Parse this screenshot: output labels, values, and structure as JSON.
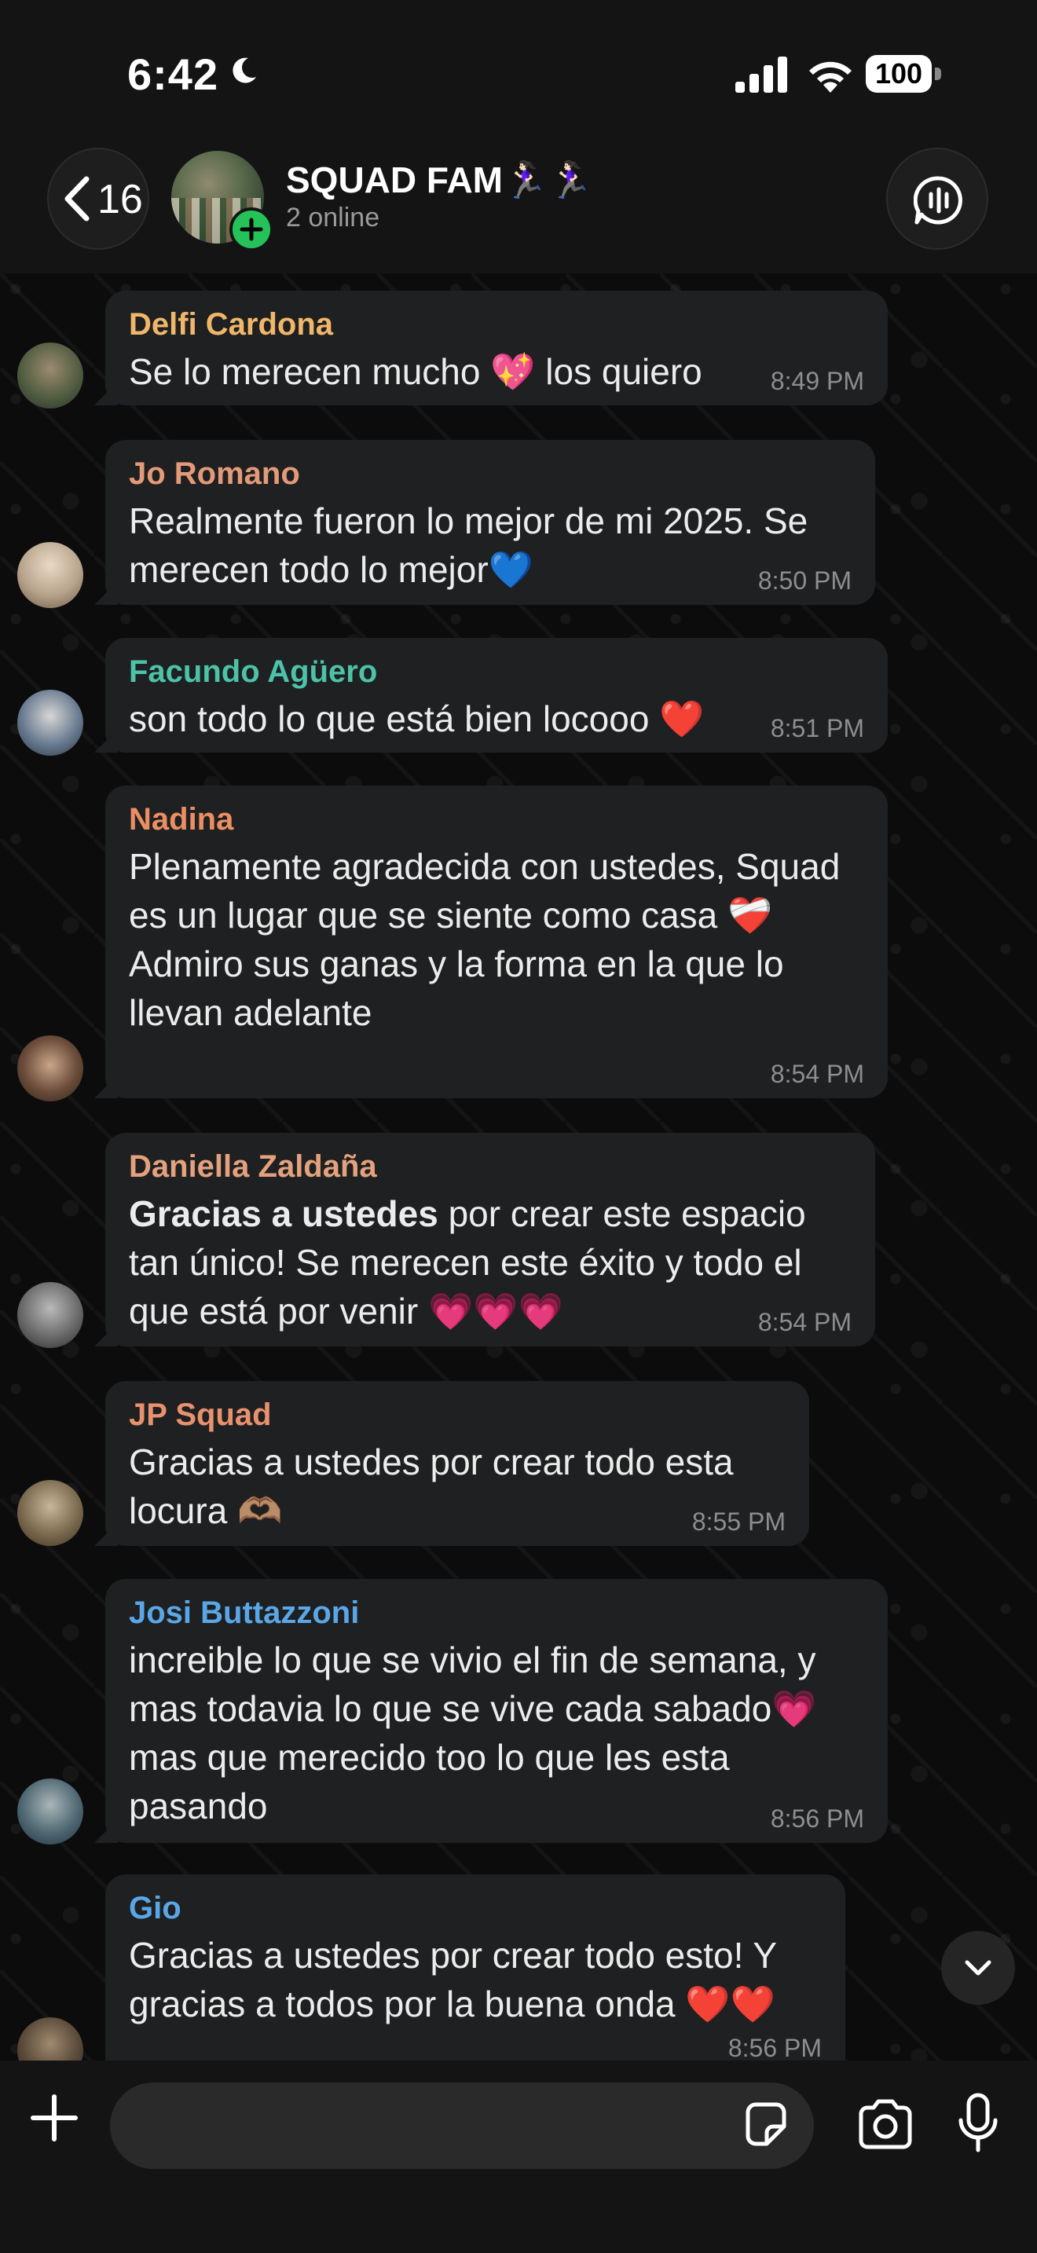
{
  "status_bar": {
    "time": "6:42",
    "battery": "100"
  },
  "header": {
    "back_count": "16",
    "group_name": "SQUAD FAM🏃🏻‍♀️🏃🏻‍♀️",
    "group_status": "2 online"
  },
  "colors": {
    "bubble": "#1f2021",
    "delfi": "#f0b76a",
    "jo": "#e39a78",
    "facundo": "#4cc2a9",
    "nadina": "#eb8f63",
    "daniella": "#e4a17e",
    "jp": "#e8916e",
    "josi": "#5aa7e8",
    "gio": "#5aa7e8"
  },
  "messages": [
    {
      "sender": "Delfi Cardona",
      "text": "Se lo merecen mucho 💖 los quiero",
      "time": "8:49 PM"
    },
    {
      "sender": "Jo Romano",
      "text": "Realmente fueron lo mejor de mi 2025. Se merecen todo lo mejor💙",
      "time": "8:50 PM"
    },
    {
      "sender": "Facundo Agüero",
      "text": "son todo lo que está bien locooo ❤️",
      "time": "8:51 PM"
    },
    {
      "sender": "Nadina",
      "line1": "Plenamente agradecida con ustedes, Squad es un lugar que se siente como casa ❤️‍🩹",
      "line2": "Admiro sus ganas y la forma en la que lo llevan adelante",
      "time": "8:54 PM"
    },
    {
      "sender": "Daniella Zaldaña",
      "bold": "Gracias a ustedes",
      "text": " por crear este espacio tan único! Se merecen este éxito y todo el que está por venir 💗💗💗",
      "time": "8:54 PM"
    },
    {
      "sender": "JP Squad",
      "text": "Gracias a ustedes por crear  todo esta locura 🫶🏽",
      "time": "8:55 PM"
    },
    {
      "sender": "Josi Buttazzoni",
      "text": "increible lo que se vivio el fin de semana, y mas todavia lo que se vive cada sabado💗 mas que merecido too lo que les esta pasando",
      "time": "8:56 PM"
    },
    {
      "sender": "Gio",
      "text": "Gracias a ustedes por crear todo esto! Y gracias a todos por la buena onda ❤️❤️",
      "time": "8:56 PM"
    }
  ],
  "icons": {
    "moon": "moon-icon",
    "signal": "signal-icon",
    "wifi": "wifi-icon",
    "back": "chevron-left-icon",
    "add": "plus-badge-icon",
    "voice": "voice-chat-icon",
    "scroll": "chevron-down-icon",
    "attach": "plus-icon",
    "sticker": "sticker-icon",
    "camera": "camera-icon",
    "mic": "microphone-icon"
  }
}
